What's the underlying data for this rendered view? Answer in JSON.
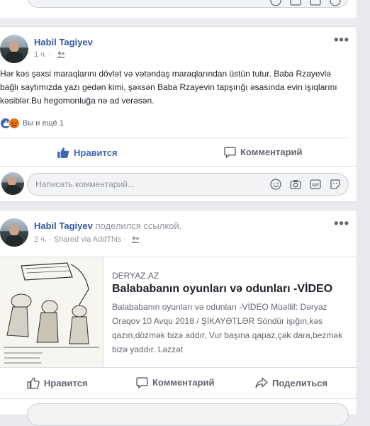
{
  "post1": {
    "author": "Habil Tagiyev",
    "time": "1 ч.",
    "text": "Hər kəs şəxsi maraqlarını dövlət və vətəndaş maraqlarından üstün tutur. Baba Rzayevlə bağlı saytımızda yazı gedən kimi, şəxsən Baba Rzayevin tapşırığı əsasında evin işıqlarını kəsiblər.Bu hegomonluğa nə ad verəsən.",
    "reactions_text": "Вы и ещё 1",
    "like_label": "Нравится",
    "comment_label": "Комментарий",
    "comment_placeholder": "Написать комментарий..."
  },
  "post2": {
    "author": "Habil Tagiyev",
    "shared_text": "поделился ссылкой.",
    "time": "2 ч.",
    "via": "Shared via AddThis",
    "link_domain": "DERYAZ.AZ",
    "link_title": "Balababanın oyunları və odunları -VİDEO",
    "link_desc": "Balababanın oyunları və odunları -VİDEO Müəllif: Dəryaz Oraqov 10 Avqu 2018 / ŞİKAYƏTLƏR Söndür işığın,kəs qazın,dözmək bizə addır, Vur başına qapaz,çək dara,bezmək bizə yaddır. Ləzzət",
    "like_label": "Нравится",
    "comment_label": "Комментарий",
    "share_label": "Поделиться"
  },
  "colors": {
    "link_blue": "#365899",
    "active_blue": "#4267b2",
    "muted": "#90949c",
    "background": "#e9ebee"
  }
}
